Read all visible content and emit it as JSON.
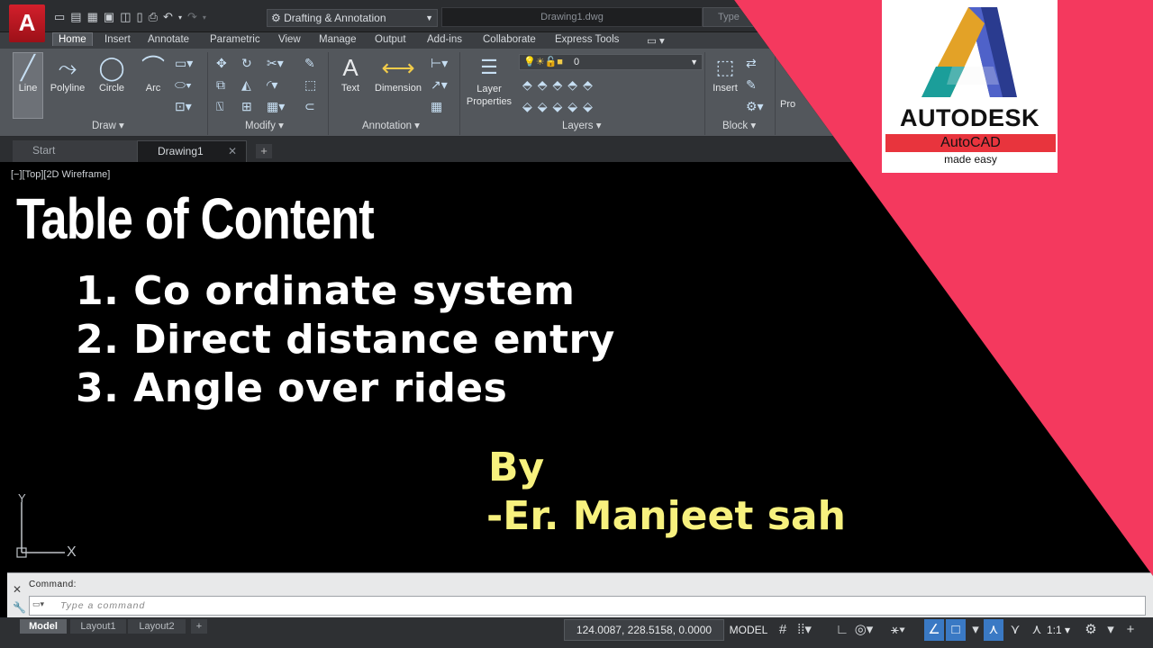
{
  "titlebar": {
    "app_logo": "A",
    "workspace": "Drafting & Annotation",
    "document": "Drawing1.dwg",
    "search_placeholder": "Type"
  },
  "ribbon_tabs": [
    "Home",
    "Insert",
    "Annotate",
    "Parametric",
    "View",
    "Manage",
    "Output",
    "Add-ins",
    "Collaborate",
    "Express Tools"
  ],
  "ribbon": {
    "draw_tools": [
      "Line",
      "Polyline",
      "Circle",
      "Arc"
    ],
    "text_tool": "Text",
    "dimension_tool": "Dimension",
    "layer_properties": [
      "Layer",
      "Properties"
    ],
    "layer_value": "0",
    "insert_tool": "Insert",
    "truncated_tool": "Pro",
    "panels": [
      "Draw ▾",
      "Modify ▾",
      "Annotation ▾",
      "Layers ▾",
      "Block ▾"
    ]
  },
  "file_tabs": {
    "start": "Start",
    "drawing": "Drawing1",
    "add": "+"
  },
  "viewport": {
    "label": "[−][Top][2D Wireframe]",
    "ucs_y": "Y",
    "ucs_x": "X"
  },
  "content": {
    "title": "Table of Content",
    "items": [
      "1. Co ordinate system",
      "2. Direct distance entry",
      "3. Angle over rides"
    ],
    "by": "By",
    "author": "-Er. Manjeet sah"
  },
  "command": {
    "history": "Command:",
    "placeholder": "Type a command"
  },
  "layout_tabs": [
    "Model",
    "Layout1",
    "Layout2",
    "+"
  ],
  "statusbar": {
    "coords": "124.0087, 228.5158, 0.0000",
    "model": "MODEL",
    "scale": "1:1 ▾"
  },
  "badge": {
    "brand": "AUTODESK",
    "product": "AutoCAD",
    "tagline": "made easy"
  },
  "colors": {
    "pink": "#f4395e",
    "author": "#f7f17e",
    "ribbon": "#53575c",
    "badge_red": "#e8343d"
  }
}
